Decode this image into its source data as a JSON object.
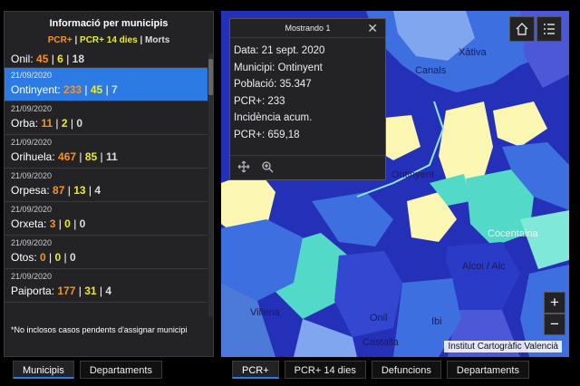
{
  "panel": {
    "title": "Informació per municipis",
    "legend": {
      "pcr": "PCR+",
      "sep1": " | ",
      "pcr14": "PCR+ 14 dies",
      "sep2": " | ",
      "morts": "Morts"
    },
    "items": [
      {
        "date": "",
        "name": "Onil",
        "pcr": "45",
        "pcr14": "6",
        "morts": "18"
      },
      {
        "date": "21/09/2020",
        "name": "Ontinyent",
        "pcr": "233",
        "pcr14": "45",
        "morts": "7"
      },
      {
        "date": "21/09/2020",
        "name": "Orba",
        "pcr": "11",
        "pcr14": "2",
        "morts": "0"
      },
      {
        "date": "21/09/2020",
        "name": "Orihuela",
        "pcr": "467",
        "pcr14": "85",
        "morts": "11"
      },
      {
        "date": "21/09/2020",
        "name": "Orpesa",
        "pcr": "87",
        "pcr14": "13",
        "morts": "4"
      },
      {
        "date": "21/09/2020",
        "name": "Orxeta",
        "pcr": "3",
        "pcr14": "0",
        "morts": "0"
      },
      {
        "date": "21/09/2020",
        "name": "Otos",
        "pcr": "0",
        "pcr14": "0",
        "morts": "0"
      },
      {
        "date": "21/09/2020",
        "name": "Paiporta",
        "pcr": "177",
        "pcr14": "31",
        "morts": "4"
      }
    ],
    "selected_index": 1,
    "footnote": "*No inclosos casos pendents d'assignar municipi",
    "tabs": [
      "Municipis",
      "Departaments"
    ]
  },
  "popup": {
    "title": "Mostrando 1",
    "close": "✕",
    "lines": [
      "Data: 21 sept. 2020",
      "Municipi: Ontinyent",
      "Població: 35.347",
      "PCR+: 233",
      "Incidència acum.",
      "PCR+: 659,18"
    ]
  },
  "map": {
    "labels": [
      "Xàtiva",
      "Canals",
      "Ontinyent",
      "Cocentaina",
      "Alcoi / Alc",
      "Villena",
      "Onil",
      "Ibi",
      "Castalla"
    ],
    "zoom_in": "+",
    "zoom_out": "−",
    "attribution": "Institut Cartogràfic Valencià",
    "tabs": [
      "PCR+",
      "PCR+ 14 dies",
      "Defuncions",
      "Departaments"
    ]
  },
  "colors": {
    "selected": "#2c7be5",
    "pcr": "#f7941d",
    "pcr14": "#ecec28",
    "dark_blue": "#2530b8",
    "mid_blue": "#3d6fe0",
    "teal": "#52d9c8",
    "pale_yellow": "#fbf6b2"
  }
}
